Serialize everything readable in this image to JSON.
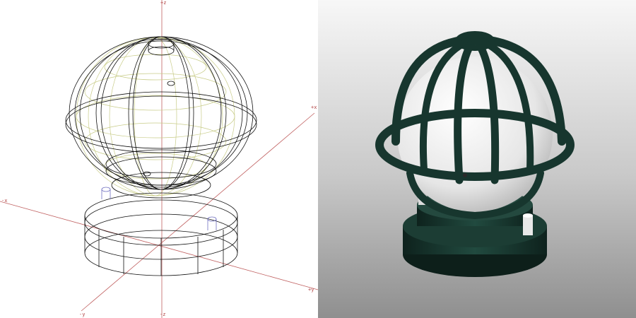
{
  "viewports": {
    "wireframe": {
      "shading": "wireframe"
    },
    "render": {
      "shading": "rendered"
    }
  },
  "axis_labels": {
    "top": "+z",
    "right_upper": "+x",
    "left": "-x",
    "right_lower": "+y",
    "bottom_left": "-y",
    "bottom": "-z"
  },
  "colors": {
    "axis": "#c06060",
    "wire": "#111111",
    "globe_wire": "#c8cc88",
    "frame": "#17362e",
    "globe": "#f2f2f2"
  }
}
